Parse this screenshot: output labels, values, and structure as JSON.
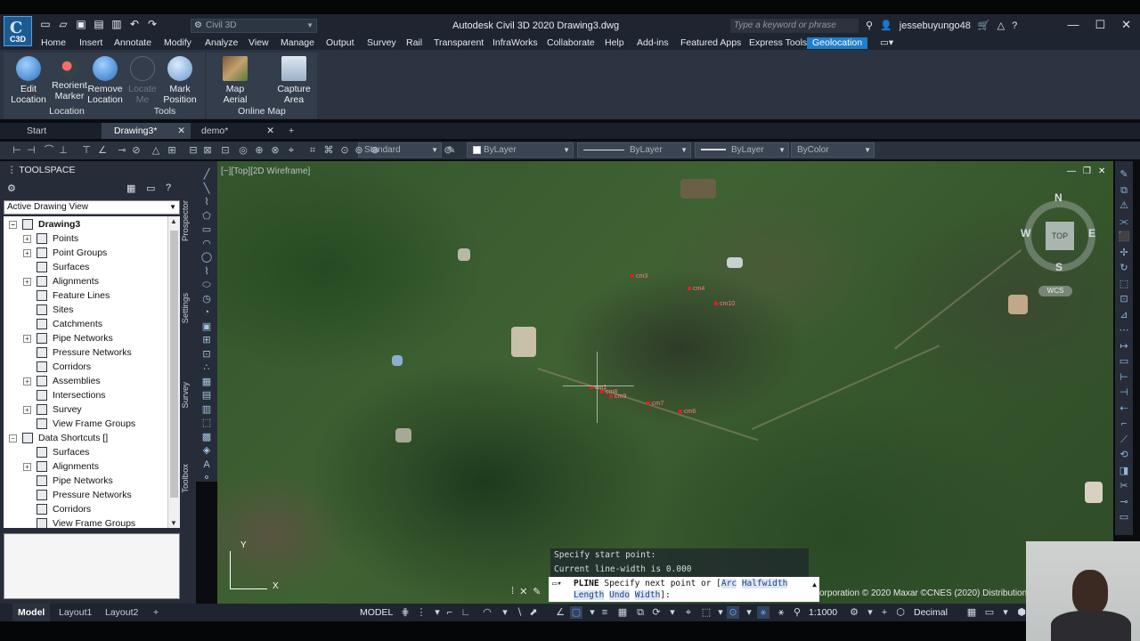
{
  "app": {
    "logo_text": "C3D",
    "workspace": "Civil 3D",
    "title": "Autodesk Civil 3D 2020   Drawing3.dwg",
    "search_placeholder": "Type a keyword or phrase",
    "user": "jessebuyungo48"
  },
  "menu": {
    "tabs": [
      "Home",
      "Insert",
      "Annotate",
      "Modify",
      "Analyze",
      "View",
      "Manage",
      "Output",
      "Survey",
      "Rail",
      "Transparent",
      "InfraWorks",
      "Collaborate",
      "Help",
      "Add-ins",
      "Featured Apps",
      "Express Tools",
      "Geolocation"
    ],
    "active": "Geolocation"
  },
  "ribbon": {
    "buttons": {
      "edit_location": "Edit Location",
      "reorient_marker": "Reorient Marker",
      "remove_location": "Remove Location",
      "locate_me": "Locate Me",
      "mark_position": "Mark Position",
      "map_aerial": "Map Aerial",
      "capture_area": "Capture Area"
    },
    "panels": {
      "location": "Location",
      "tools": "Tools",
      "online_map": "Online Map"
    }
  },
  "doc_tabs": [
    "Start",
    "Drawing3*",
    "demo*"
  ],
  "toolbar": {
    "style": "Standard",
    "layer": "ByLayer",
    "linetype": "ByLayer",
    "lineweight": "ByLayer",
    "color": "ByColor"
  },
  "toolspace": {
    "title": "TOOLSPACE",
    "view_select": "Active Drawing View",
    "tree": [
      {
        "label": "Drawing3",
        "level": 0,
        "toggle": "−",
        "bold": true
      },
      {
        "label": "Points",
        "level": 1,
        "toggle": "+"
      },
      {
        "label": "Point Groups",
        "level": 1,
        "toggle": "+"
      },
      {
        "label": "Surfaces",
        "level": 1,
        "toggle": ""
      },
      {
        "label": "Alignments",
        "level": 1,
        "toggle": "+"
      },
      {
        "label": "Feature Lines",
        "level": 1,
        "toggle": ""
      },
      {
        "label": "Sites",
        "level": 1,
        "toggle": ""
      },
      {
        "label": "Catchments",
        "level": 1,
        "toggle": ""
      },
      {
        "label": "Pipe Networks",
        "level": 1,
        "toggle": "+"
      },
      {
        "label": "Pressure Networks",
        "level": 1,
        "toggle": ""
      },
      {
        "label": "Corridors",
        "level": 1,
        "toggle": ""
      },
      {
        "label": "Assemblies",
        "level": 1,
        "toggle": "+"
      },
      {
        "label": "Intersections",
        "level": 1,
        "toggle": ""
      },
      {
        "label": "Survey",
        "level": 1,
        "toggle": "+"
      },
      {
        "label": "View Frame Groups",
        "level": 1,
        "toggle": ""
      },
      {
        "label": "Data Shortcuts []",
        "level": 0,
        "toggle": "−"
      },
      {
        "label": "Surfaces",
        "level": 1,
        "toggle": ""
      },
      {
        "label": "Alignments",
        "level": 1,
        "toggle": "+"
      },
      {
        "label": "Pipe Networks",
        "level": 1,
        "toggle": ""
      },
      {
        "label": "Pressure Networks",
        "level": 1,
        "toggle": ""
      },
      {
        "label": "Corridors",
        "level": 1,
        "toggle": ""
      },
      {
        "label": "View Frame Groups",
        "level": 1,
        "toggle": ""
      }
    ],
    "side_tabs": [
      "Prospector",
      "Settings",
      "Survey",
      "Toolbox"
    ]
  },
  "viewport": {
    "label": "[−][Top][2D Wireframe]",
    "markers": [
      "cm3",
      "cm4",
      "cm10",
      "cm1",
      "cm8",
      "cm9",
      "cm7",
      "cm6"
    ],
    "viewcube": {
      "top": "TOP",
      "north": "N",
      "south": "S",
      "east": "E",
      "west": "W",
      "wcs": "WCS"
    },
    "ucs": {
      "x": "X",
      "y": "Y"
    },
    "copyright": "orporation © 2020 Maxar ©CNES (2020) Distribution A"
  },
  "command": {
    "history": [
      "Specify start point:",
      "Current line-width is 0.000"
    ],
    "name": "PLINE",
    "prompt": "Specify next point or [",
    "options": [
      "Arc",
      "Halfwidth",
      "Length",
      "Undo",
      "Width"
    ],
    "end": "]:"
  },
  "status": {
    "layouts": [
      "Model",
      "Layout1",
      "Layout2"
    ],
    "model": "MODEL",
    "scale": "1:1000",
    "units": "Decimal"
  }
}
